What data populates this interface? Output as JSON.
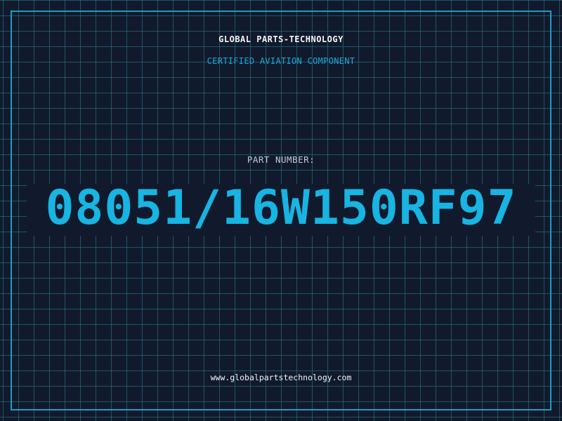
{
  "header": {
    "company": "GLOBAL PARTS-TECHNOLOGY",
    "subtitle": "CERTIFIED AVIATION COMPONENT"
  },
  "part": {
    "label": "PART NUMBER:",
    "number": "08051/16W150RF97"
  },
  "footer": {
    "website": "www.globalpartstechnology.com"
  },
  "colors": {
    "background": "#111a2c",
    "grid": "#268498",
    "frame": "#1f9cc4",
    "accent": "#18b4e2",
    "text": "#f2f4f7",
    "muted": "#c4cad4"
  }
}
